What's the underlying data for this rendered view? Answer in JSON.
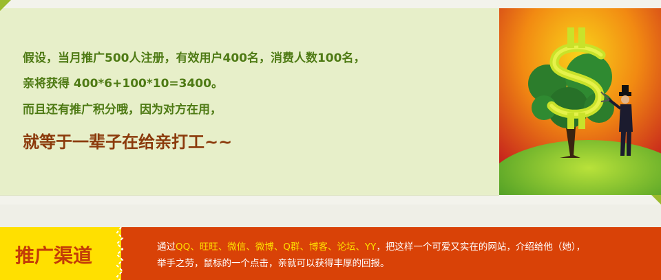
{
  "promo": {
    "line1": "假设，当月推广500人注册，有效用户400名，消费人数100名，",
    "line2": "亲将获得 400*6+100*10=3400。",
    "line3": "而且还有推广积分哦，因为对方在用，",
    "highlight": "就等于一辈子在给亲打工~~"
  },
  "channel": {
    "label": "推广渠道",
    "prefix": "通过",
    "platforms": "QQ、旺旺、微信、微博、Q群、博客、论坛、YY",
    "suffix": "，把这样一个可爱又实在的网站，介绍给他（她），",
    "line2": "举手之劳，鼠标的一个点击，亲就可以获得丰厚的回报。"
  },
  "colors": {
    "panel_bg": "#e7efc9",
    "promo_text": "#4e7a14",
    "highlight_text": "#8b3a0b",
    "channel_bg": "#d94207",
    "label_bg": "#ffe000",
    "platform_text": "#ffe000"
  },
  "icons": {
    "art": "dollar-tree-illustration"
  }
}
